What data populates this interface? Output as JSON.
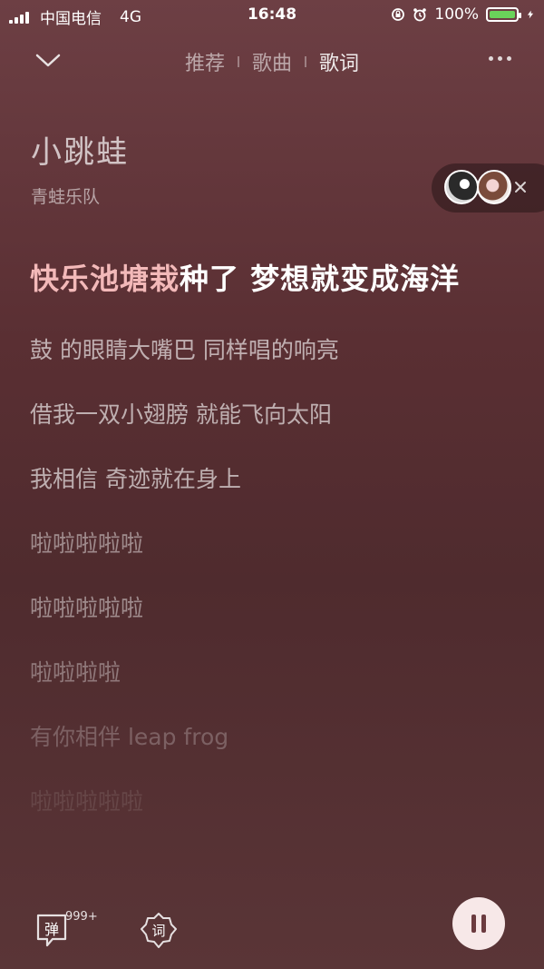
{
  "status_bar": {
    "carrier": "中国电信",
    "network": "4G",
    "time": "16:48",
    "battery": "100%"
  },
  "nav": {
    "tabs": [
      {
        "label": "推荐"
      },
      {
        "label": "歌曲"
      },
      {
        "label": "歌词"
      }
    ]
  },
  "song": {
    "title": "小跳蛙",
    "artist": "青蛙乐队"
  },
  "lyrics": {
    "current_sung": "快乐池塘栽",
    "current_rest": "种了 梦想就变成海洋",
    "lines": [
      {
        "text": "鼓 的眼睛大嘴巴 同样唱的响亮",
        "opacity": 0.62
      },
      {
        "text": "借我一双小翅膀 就能飞向太阳",
        "opacity": 0.62
      },
      {
        "text": "我相信 奇迹就在身上",
        "opacity": 0.62
      },
      {
        "text": "啦啦啦啦啦",
        "opacity": 0.45
      },
      {
        "text": "啦啦啦啦啦",
        "opacity": 0.45
      },
      {
        "text": "啦啦啦啦",
        "opacity": 0.36
      },
      {
        "text": "有你相伴 leap frog",
        "opacity": 0.24
      },
      {
        "text": "啦啦啦啦啦",
        "opacity": 0.1
      }
    ]
  },
  "controls": {
    "danmaku_label": "弹",
    "danmaku_count": "999+",
    "lyric_label": "词"
  },
  "colors": {
    "background": "#5a2f33",
    "highlight": "#f3b9b9",
    "battery_fill": "#6ad35a",
    "pause_button": "#f7e8e8"
  }
}
